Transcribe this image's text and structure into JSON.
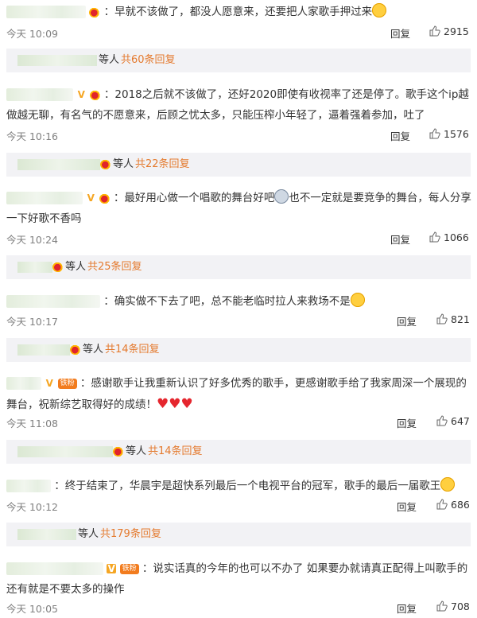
{
  "reply_label": "回复",
  "people_label": "等人",
  "comments": [
    {
      "text": "：早就不该做了，都没人愿意来，还要把人家歌手押过来",
      "time": "今天 10:09",
      "likes": "2915",
      "sub_total": "共60条回复"
    },
    {
      "text": "：2018之后就不该做了，还好2020即使有收视率了还是停了。歌手这个ip越做越无聊，有名气的不愿意来，后顾之忧太多，只能压榨小年轻了，逼着强着参加，吐了",
      "time": "今天 10:16",
      "likes": "1576",
      "sub_total": "共22条回复"
    },
    {
      "text": "：最好用心做一个唱歌的舞台好吧",
      "text2": "也不一定就是要竞争的舞台，每人分享一下好歌不香吗",
      "time": "今天 10:24",
      "likes": "1066",
      "sub_total": "共25条回复"
    },
    {
      "text": "：确实做不下去了吧，总不能老临时拉人来救场不是",
      "time": "今天 10:17",
      "likes": "821",
      "sub_total": "共14条回复"
    },
    {
      "text": "：感谢歌手让我重新认识了好多优秀的歌手，更感谢歌手给了我家周深一个展现的舞台，祝新综艺取得好的成绩！",
      "fan_badge": "铁粉",
      "time": "今天 11:08",
      "likes": "647",
      "sub_total": "共14条回复"
    },
    {
      "text": "：终于结束了，华晨宇是超快系列最后一个电视平台的冠军，歌手的最后一届歌王",
      "time": "今天 10:12",
      "likes": "686",
      "sub_total": "共179条回复"
    },
    {
      "text": "：说实话真的今年的也可以不办了 如果要办就请真正配得上叫歌手的 还有就是不要太多的操作",
      "fan_badge": "铁粉",
      "time": "今天 10:05",
      "likes": "708"
    }
  ]
}
